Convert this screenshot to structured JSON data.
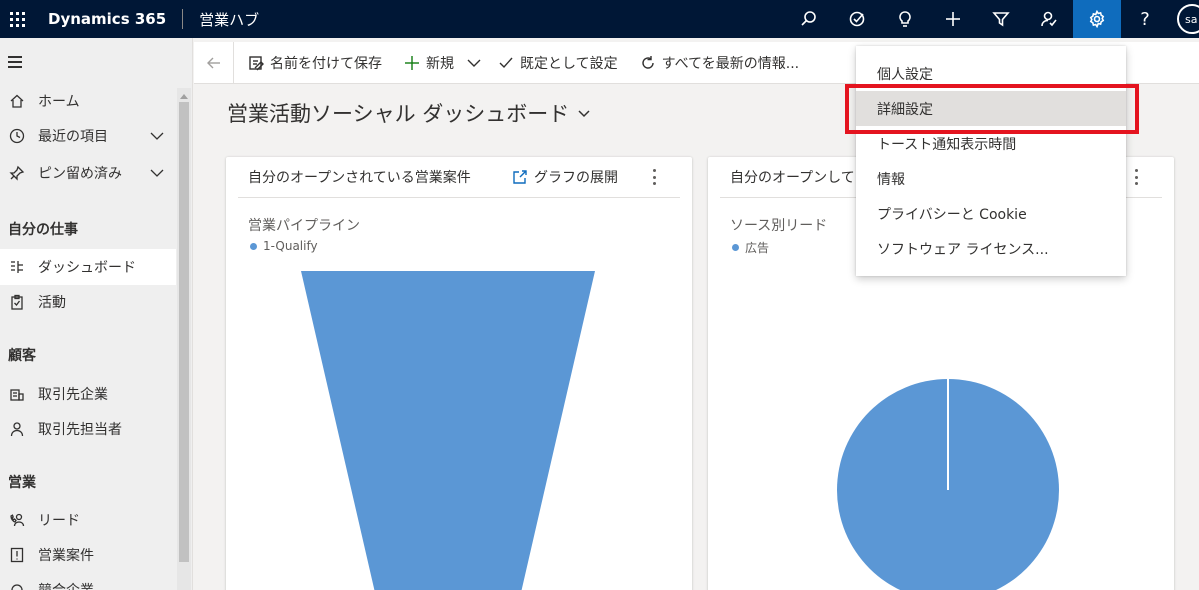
{
  "topbar": {
    "brand": "Dynamics 365",
    "app_title": "営業ハブ",
    "icons": [
      "search-icon",
      "task-icon",
      "lightbulb-icon",
      "plus-icon",
      "filter-icon",
      "assistant-icon",
      "gear-icon",
      "help-icon"
    ],
    "help_glyph": "?",
    "avatar_initials": "sa",
    "accent_color": "#0f6cbd",
    "bar_color": "#001736"
  },
  "nav": {
    "items_top": [
      {
        "label": "ホーム",
        "icon": "home-icon"
      },
      {
        "label": "最近の項目",
        "icon": "clock-icon",
        "expandable": true
      },
      {
        "label": "ピン留め済み",
        "icon": "pin-icon",
        "expandable": true
      }
    ],
    "groups": [
      {
        "title": "自分の仕事",
        "items": [
          {
            "label": "ダッシュボード",
            "icon": "dashboard-icon",
            "active": true
          },
          {
            "label": "活動",
            "icon": "clipboard-icon"
          }
        ]
      },
      {
        "title": "顧客",
        "items": [
          {
            "label": "取引先企業",
            "icon": "building-icon"
          },
          {
            "label": "取引先担当者",
            "icon": "person-icon"
          }
        ]
      },
      {
        "title": "営業",
        "items": [
          {
            "label": "リード",
            "icon": "phone-person-icon"
          },
          {
            "label": "営業案件",
            "icon": "opportunity-icon"
          },
          {
            "label": "競合企業",
            "icon": "competitor-icon"
          }
        ]
      }
    ]
  },
  "commandbar": {
    "save_as": "名前を付けて保存",
    "new": "新規",
    "set_default": "既定として設定",
    "refresh_all": "すべてを最新の情報..."
  },
  "dashboard": {
    "title": "営業活動ソーシャル ダッシュボード"
  },
  "cards": [
    {
      "title": "自分のオープンされている営業案件",
      "expand_label": "グラフの展開",
      "chart_title": "営業パイプライン",
      "legend": "1-Qualify",
      "color": "#5b97d5"
    },
    {
      "title": "自分のオープンして",
      "chart_title": "ソース別リード",
      "legend": "広告",
      "color": "#5b97d5"
    }
  ],
  "settings_menu": {
    "items": [
      "個人設定",
      "詳細設定",
      "トースト通知表示時間",
      "情報",
      "プライバシーと Cookie",
      "ソフトウェア ライセンス..."
    ],
    "highlighted": "詳細設定",
    "annotation_color": "#e4141f"
  }
}
